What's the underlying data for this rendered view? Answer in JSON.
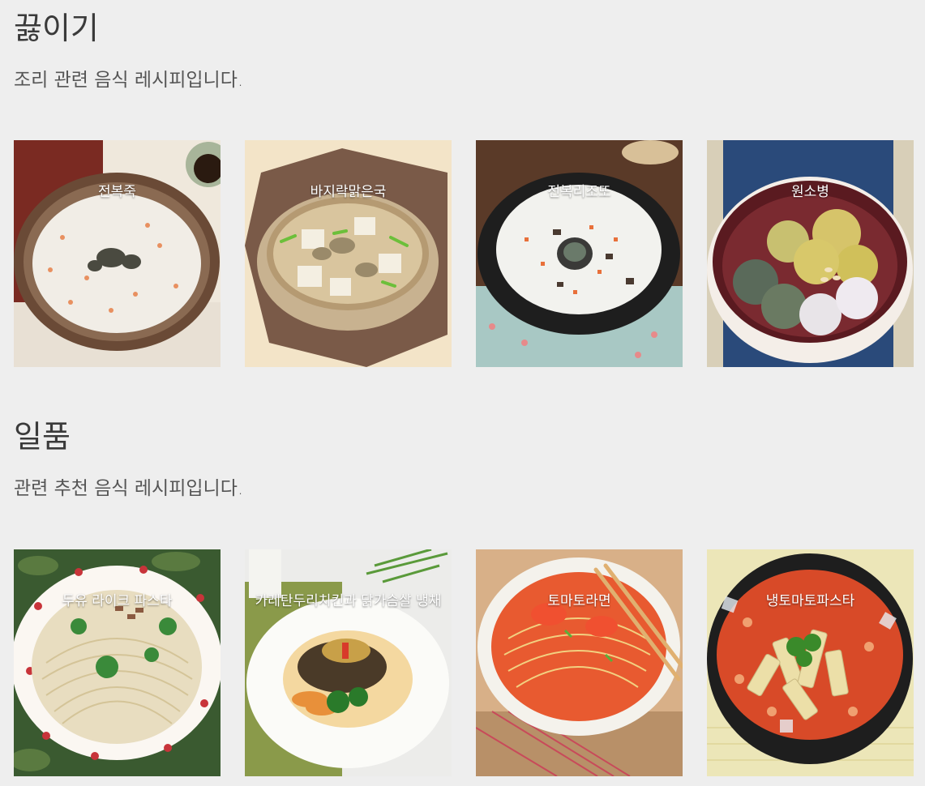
{
  "sections": [
    {
      "title": "끓이기",
      "description": "조리 관련 음식 레시피입니다.",
      "items": [
        {
          "label": "전복죽",
          "image": "abalone-porridge-image"
        },
        {
          "label": "바지락맑은국",
          "image": "clam-clear-soup-image"
        },
        {
          "label": "전복리조또",
          "image": "abalone-risotto-image"
        },
        {
          "label": "원소병",
          "image": "wonsobyeong-image"
        }
      ]
    },
    {
      "title": "일품",
      "description": "관련 추천 음식 레시피입니다.",
      "items": [
        {
          "label": "두유 라이크 파스타",
          "image": "soymilk-pasta-image"
        },
        {
          "label": "카레탄두리치킨과 닭가슴살 냉채",
          "image": "curry-tandoori-chicken-image"
        },
        {
          "label": "토마토라면",
          "image": "tomato-ramen-image"
        },
        {
          "label": "냉토마토파스타",
          "image": "cold-tomato-pasta-image"
        }
      ]
    }
  ]
}
